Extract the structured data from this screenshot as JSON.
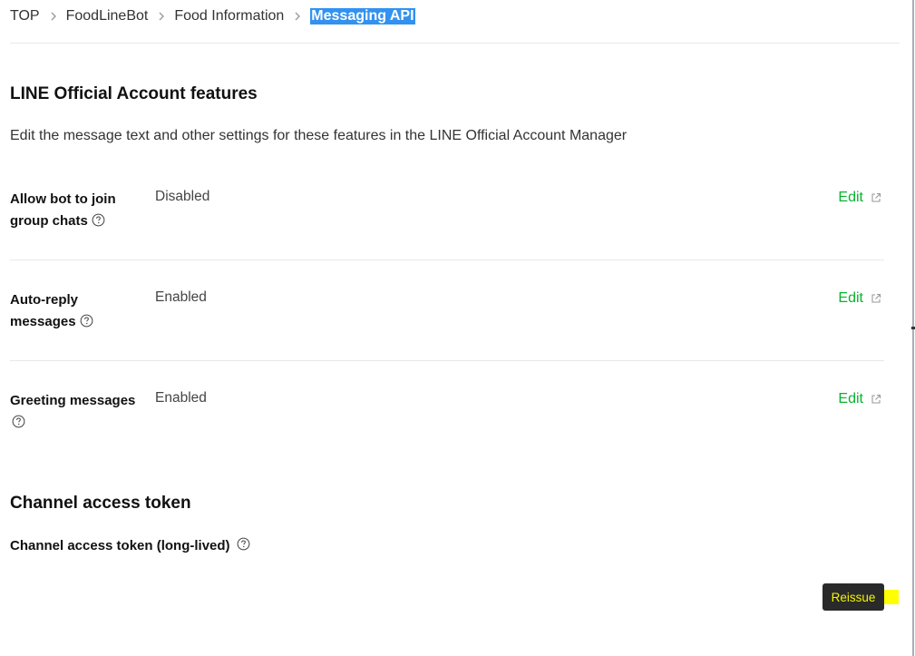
{
  "breadcrumb": {
    "items": [
      "TOP",
      "FoodLineBot",
      "Food Information"
    ],
    "current": "Messaging API",
    "highlight_color": "#3392f0"
  },
  "features": {
    "title": "LINE Official Account features",
    "description": "Edit the message text and other settings for these features in the LINE Official Account Manager",
    "rows": [
      {
        "label_line1": "Allow bot to join",
        "label_line2": "group chats",
        "value": "Disabled",
        "edit_label": "Edit"
      },
      {
        "label_line1": "Auto-reply",
        "label_line2": "messages",
        "value": "Enabled",
        "edit_label": "Edit"
      },
      {
        "label_line1": "Greeting messages",
        "label_line2": "",
        "value": "Enabled",
        "edit_label": "Edit"
      }
    ]
  },
  "token": {
    "title": "Channel access token",
    "label": "Channel access token (long-lived)",
    "reissue_label": "Reissue"
  },
  "colors": {
    "link_green": "#06b330",
    "button_bg": "#2a2a2a",
    "button_text": "#f5f500",
    "divider": "#e8e8e8"
  },
  "icons": {
    "help": "question-circle-icon",
    "external": "external-link-icon",
    "separator": "chevron-right-icon"
  }
}
